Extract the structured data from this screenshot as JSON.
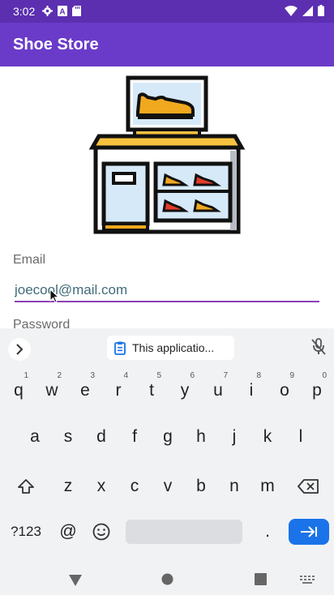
{
  "status_bar": {
    "time": "3:02",
    "left_icons": [
      "gear-icon",
      "a-badge-icon",
      "sd-card-icon"
    ],
    "right_icons": [
      "wifi-icon",
      "signal-icon",
      "battery-icon"
    ]
  },
  "app_bar": {
    "title": "Shoe Store"
  },
  "form": {
    "email_label": "Email",
    "email_value": "joecool@mail.com",
    "password_label": "Password"
  },
  "keyboard": {
    "clipboard_chip": "This applicatio...",
    "row1": [
      {
        "k": "q",
        "h": "1"
      },
      {
        "k": "w",
        "h": "2"
      },
      {
        "k": "e",
        "h": "3"
      },
      {
        "k": "r",
        "h": "4"
      },
      {
        "k": "t",
        "h": "5"
      },
      {
        "k": "y",
        "h": "6"
      },
      {
        "k": "u",
        "h": "7"
      },
      {
        "k": "i",
        "h": "8"
      },
      {
        "k": "o",
        "h": "9"
      },
      {
        "k": "p",
        "h": "0"
      }
    ],
    "row2": [
      "a",
      "s",
      "d",
      "f",
      "g",
      "h",
      "j",
      "k",
      "l"
    ],
    "row3": [
      "z",
      "x",
      "c",
      "v",
      "b",
      "n",
      "m"
    ],
    "symbols_key": "?123",
    "at_key": "@",
    "period_key": "."
  },
  "colors": {
    "status_bar": "#5b2fb0",
    "app_bar": "#6a3bc9",
    "accent_underline": "#8e3fb6",
    "enter_key": "#1a73e8"
  }
}
